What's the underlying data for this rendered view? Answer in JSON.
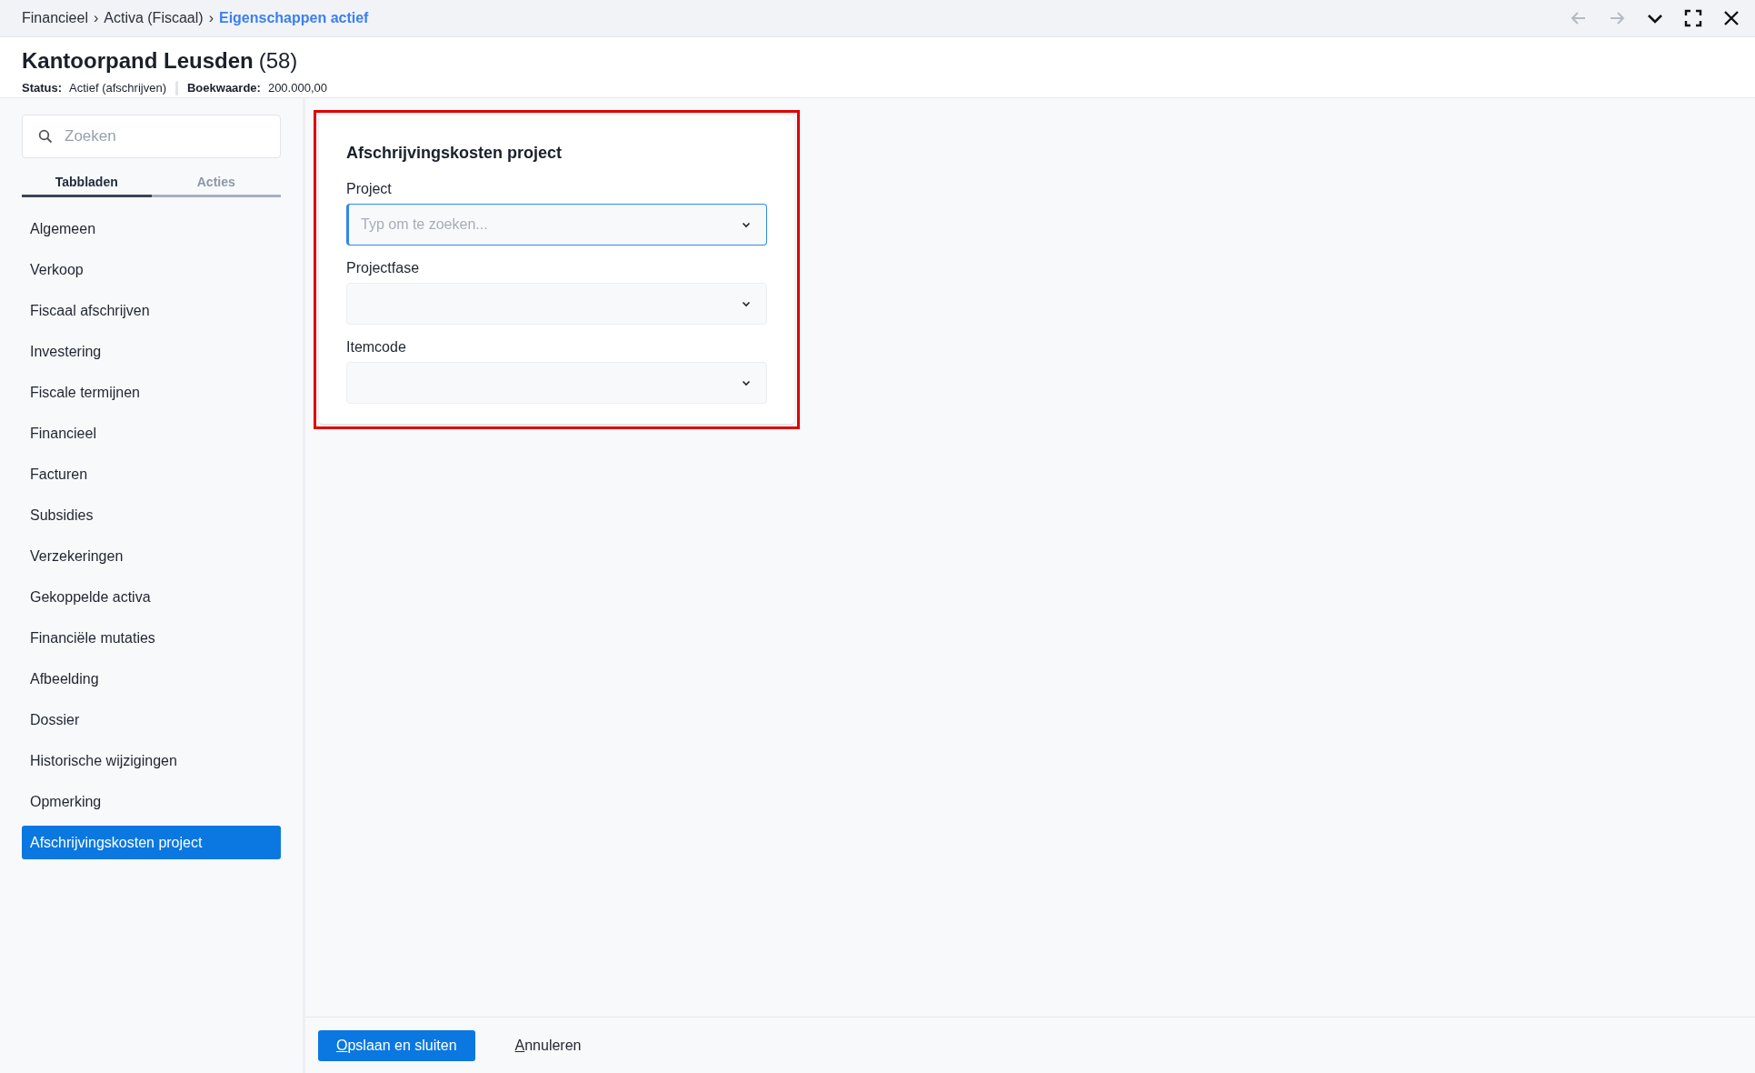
{
  "breadcrumb": [
    {
      "label": "Financieel",
      "current": false
    },
    {
      "label": "Activa (Fiscaal)",
      "current": false
    },
    {
      "label": "Eigenschappen actief",
      "current": true
    }
  ],
  "separator": "›",
  "window_controls": [
    {
      "kind": "back",
      "disabled": true
    },
    {
      "kind": "forward",
      "disabled": true
    },
    {
      "kind": "collapse",
      "disabled": false
    },
    {
      "kind": "maximize",
      "disabled": false
    },
    {
      "kind": "close",
      "disabled": false
    }
  ],
  "header": {
    "title": "Kantoorpand Leusden",
    "count": "(58)",
    "fields": [
      {
        "label": "Status:",
        "value": "Actief (afschrijven)"
      },
      {
        "label": "Boekwaarde:",
        "value": "200.000,00"
      }
    ]
  },
  "sidebar": {
    "search": {
      "placeholder": "Zoeken"
    },
    "tabs": [
      {
        "label": "Tabbladen",
        "selected": true
      },
      {
        "label": "Acties",
        "selected": false
      }
    ],
    "items": [
      {
        "label": "Algemeen",
        "selected": false
      },
      {
        "label": "Verkoop",
        "selected": false
      },
      {
        "label": "Fiscaal afschrijven",
        "selected": false
      },
      {
        "label": "Investering",
        "selected": false
      },
      {
        "label": "Fiscale termijnen",
        "selected": false
      },
      {
        "label": "Financieel",
        "selected": false
      },
      {
        "label": "Facturen",
        "selected": false
      },
      {
        "label": "Subsidies",
        "selected": false
      },
      {
        "label": "Verzekeringen",
        "selected": false
      },
      {
        "label": "Gekoppelde activa",
        "selected": false
      },
      {
        "label": "Financiële mutaties",
        "selected": false
      },
      {
        "label": "Afbeelding",
        "selected": false
      },
      {
        "label": "Dossier",
        "selected": false
      },
      {
        "label": "Historische wijzigingen",
        "selected": false
      },
      {
        "label": "Opmerking",
        "selected": false
      },
      {
        "label": "Afschrijvingskosten project",
        "selected": true
      }
    ]
  },
  "form": {
    "title": "Afschrijvingskosten project",
    "highlighted": true,
    "fields": [
      {
        "label": "Project",
        "placeholder": "Typ om te zoeken...",
        "focused": true
      },
      {
        "label": "Projectfase",
        "focused": false
      },
      {
        "label": "Itemcode",
        "focused": false
      }
    ]
  },
  "footer": {
    "buttons": [
      {
        "label": "Opslaan en sluiten",
        "kind": "primary"
      },
      {
        "label": "Annuleren",
        "kind": "link"
      }
    ]
  }
}
